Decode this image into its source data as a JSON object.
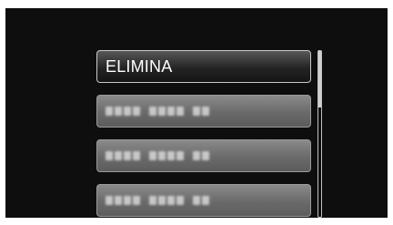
{
  "menu": {
    "items": [
      {
        "label": "ELIMINA",
        "selected": true
      },
      {
        "label": "",
        "selected": false,
        "obscured": true
      },
      {
        "label": "",
        "selected": false,
        "obscured": true
      },
      {
        "label": "",
        "selected": false,
        "obscured": true
      }
    ]
  },
  "scrollbar": {
    "position": 0,
    "visible_fraction": 0.33
  },
  "colors": {
    "background": "#0e0e0e",
    "selected_item": "#242424",
    "item": "#6a6a6a",
    "border": "#9a9a9a"
  }
}
